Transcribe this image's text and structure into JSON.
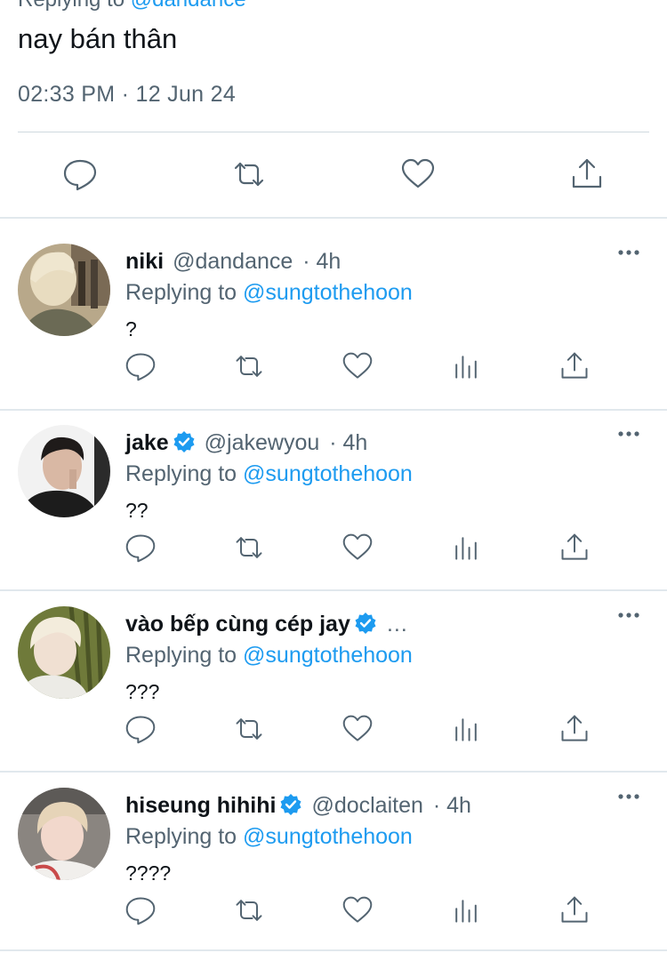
{
  "main_tweet": {
    "replying_prefix": "Replying to",
    "replying_handle": "@dandance",
    "text": "nay bán thân",
    "timestamp": "02:33 PM · 12 Jun 24"
  },
  "replies": [
    {
      "name": "niki",
      "verified": false,
      "handle": "@dandance",
      "time": "· 4h",
      "replying_prefix": "Replying to",
      "replying_handle": "@sungtothehoon",
      "text": "?"
    },
    {
      "name": "jake",
      "verified": true,
      "handle": "@jakewyou",
      "time": "· 4h",
      "replying_prefix": "Replying to",
      "replying_handle": "@sungtothehoon",
      "text": "??"
    },
    {
      "name": "vào bếp cùng cép jay",
      "verified": true,
      "handle": "…",
      "time": "",
      "replying_prefix": "Replying to",
      "replying_handle": "@sungtothehoon",
      "text": "???"
    },
    {
      "name": "hiseung hihihi",
      "verified": true,
      "handle": "@doclaiten",
      "time": "· 4h",
      "replying_prefix": "Replying to",
      "replying_handle": "@sungtothehoon",
      "text": "????"
    }
  ],
  "icons": {
    "reply": "speech-bubble-icon",
    "retweet": "retweet-icon",
    "like": "heart-icon",
    "views": "bar-chart-icon",
    "share": "share-icon",
    "more": "more-dots-icon",
    "verified": "verified-badge-icon"
  },
  "colors": {
    "link": "#1d9bf0",
    "secondary_text": "#536471",
    "text": "#0f1419",
    "verified": "#1d9bf0"
  }
}
